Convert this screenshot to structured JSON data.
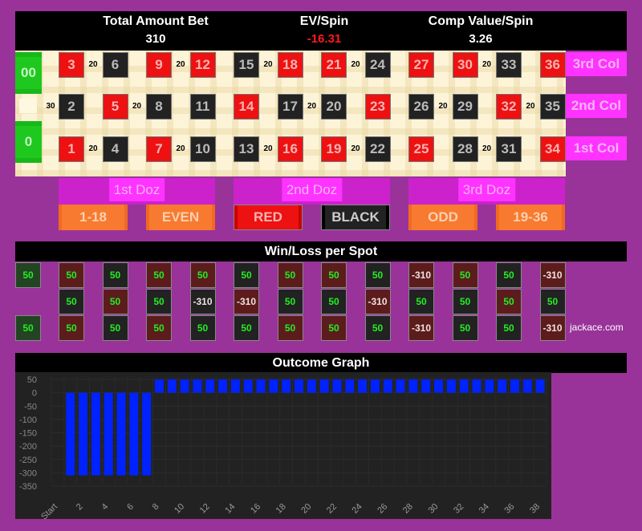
{
  "header": {
    "total_bet_label": "Total Amount Bet",
    "total_bet_value": "310",
    "ev_label": "EV/Spin",
    "ev_value": "-16.31",
    "comp_label": "Comp Value/Spin",
    "comp_value": "3.26"
  },
  "colors": {
    "ev_negative": "#ff1a1a",
    "accent": "#ff33ff",
    "bar": "#0022ff",
    "background": "#993399"
  },
  "board": {
    "zeros": [
      "00",
      "0"
    ],
    "row3": [
      {
        "n": "3",
        "c": "red"
      },
      {
        "n": "6",
        "c": "black"
      },
      {
        "n": "9",
        "c": "red"
      },
      {
        "n": "12",
        "c": "red"
      },
      {
        "n": "15",
        "c": "black"
      },
      {
        "n": "18",
        "c": "red"
      },
      {
        "n": "21",
        "c": "red"
      },
      {
        "n": "24",
        "c": "black"
      },
      {
        "n": "27",
        "c": "red"
      },
      {
        "n": "30",
        "c": "red"
      },
      {
        "n": "33",
        "c": "black"
      },
      {
        "n": "36",
        "c": "red"
      }
    ],
    "row2": [
      {
        "n": "2",
        "c": "black"
      },
      {
        "n": "5",
        "c": "red"
      },
      {
        "n": "8",
        "c": "black"
      },
      {
        "n": "11",
        "c": "black"
      },
      {
        "n": "14",
        "c": "red"
      },
      {
        "n": "17",
        "c": "black"
      },
      {
        "n": "20",
        "c": "black"
      },
      {
        "n": "23",
        "c": "red"
      },
      {
        "n": "26",
        "c": "black"
      },
      {
        "n": "29",
        "c": "black"
      },
      {
        "n": "32",
        "c": "red"
      },
      {
        "n": "35",
        "c": "black"
      }
    ],
    "row1": [
      {
        "n": "1",
        "c": "red"
      },
      {
        "n": "4",
        "c": "black"
      },
      {
        "n": "7",
        "c": "red"
      },
      {
        "n": "10",
        "c": "black"
      },
      {
        "n": "13",
        "c": "black"
      },
      {
        "n": "16",
        "c": "red"
      },
      {
        "n": "19",
        "c": "red"
      },
      {
        "n": "22",
        "c": "black"
      },
      {
        "n": "25",
        "c": "red"
      },
      {
        "n": "28",
        "c": "black"
      },
      {
        "n": "31",
        "c": "black"
      },
      {
        "n": "34",
        "c": "red"
      }
    ],
    "chips": [
      {
        "row": 3,
        "between": [
          0,
          1
        ],
        "amount": "20"
      },
      {
        "row": 3,
        "between": [
          2,
          3
        ],
        "amount": "20"
      },
      {
        "row": 3,
        "between": [
          4,
          5
        ],
        "amount": "20"
      },
      {
        "row": 3,
        "between": [
          6,
          7
        ],
        "amount": "20"
      },
      {
        "row": 3,
        "between": [
          9,
          10
        ],
        "amount": "20"
      },
      {
        "row": 2,
        "between": [
          -1,
          0
        ],
        "amount": "30"
      },
      {
        "row": 2,
        "between": [
          1,
          2
        ],
        "amount": "20"
      },
      {
        "row": 2,
        "between": [
          5,
          6
        ],
        "amount": "20"
      },
      {
        "row": 2,
        "between": [
          8,
          9
        ],
        "amount": "20"
      },
      {
        "row": 2,
        "between": [
          10,
          11
        ],
        "amount": "20"
      },
      {
        "row": 1,
        "between": [
          0,
          1
        ],
        "amount": "20"
      },
      {
        "row": 1,
        "between": [
          2,
          3
        ],
        "amount": "20"
      },
      {
        "row": 1,
        "between": [
          4,
          5
        ],
        "amount": "20"
      },
      {
        "row": 1,
        "between": [
          6,
          7
        ],
        "amount": "20"
      },
      {
        "row": 1,
        "between": [
          9,
          10
        ],
        "amount": "20"
      }
    ],
    "columns": [
      "3rd Col",
      "2nd Col",
      "1st Col"
    ],
    "dozens": [
      "1st Doz",
      "2nd Doz",
      "3rd Doz"
    ],
    "outside": [
      {
        "label": "1-18",
        "style": "orange"
      },
      {
        "label": "EVEN",
        "style": "orange"
      },
      {
        "label": "RED",
        "style": "red"
      },
      {
        "label": "BLACK",
        "style": "black"
      },
      {
        "label": "ODD",
        "style": "orange"
      },
      {
        "label": "19-36",
        "style": "orange"
      }
    ]
  },
  "winloss": {
    "title": "Win/Loss per Spot",
    "zeros": [
      "50",
      "50"
    ],
    "row3": [
      "50",
      "50",
      "50",
      "50",
      "50",
      "50",
      "50",
      "50",
      "-310",
      "50",
      "50",
      "-310"
    ],
    "row2": [
      "50",
      "50",
      "50",
      "-310",
      "-310",
      "50",
      "50",
      "-310",
      "50",
      "50",
      "50",
      "50"
    ],
    "row1": [
      "50",
      "50",
      "50",
      "50",
      "50",
      "50",
      "50",
      "50",
      "-310",
      "50",
      "50",
      "-310"
    ],
    "brand": "jackace.com"
  },
  "chart_data": {
    "type": "bar",
    "title": "Outcome Graph",
    "xlabel": "",
    "ylabel": "",
    "x_tick_labels": [
      "Start",
      "2",
      "4",
      "6",
      "8",
      "10",
      "12",
      "14",
      "16",
      "18",
      "20",
      "22",
      "24",
      "26",
      "28",
      "30",
      "32",
      "34",
      "36",
      "38"
    ],
    "y_ticks": [
      50,
      0,
      -50,
      -100,
      -150,
      -200,
      -250,
      -300,
      -350
    ],
    "ylim": [
      -350,
      50
    ],
    "x": [
      1,
      2,
      3,
      4,
      5,
      6,
      7,
      8,
      9,
      10,
      11,
      12,
      13,
      14,
      15,
      16,
      17,
      18,
      19,
      20,
      21,
      22,
      23,
      24,
      25,
      26,
      27,
      28,
      29,
      30,
      31,
      32,
      33,
      34,
      35,
      36,
      37,
      38
    ],
    "values": [
      -310,
      -310,
      -310,
      -310,
      -310,
      -310,
      -310,
      50,
      50,
      50,
      50,
      50,
      50,
      50,
      50,
      50,
      50,
      50,
      50,
      50,
      50,
      50,
      50,
      50,
      50,
      50,
      50,
      50,
      50,
      50,
      50,
      50,
      50,
      50,
      50,
      50,
      50,
      50
    ],
    "grid": true
  }
}
